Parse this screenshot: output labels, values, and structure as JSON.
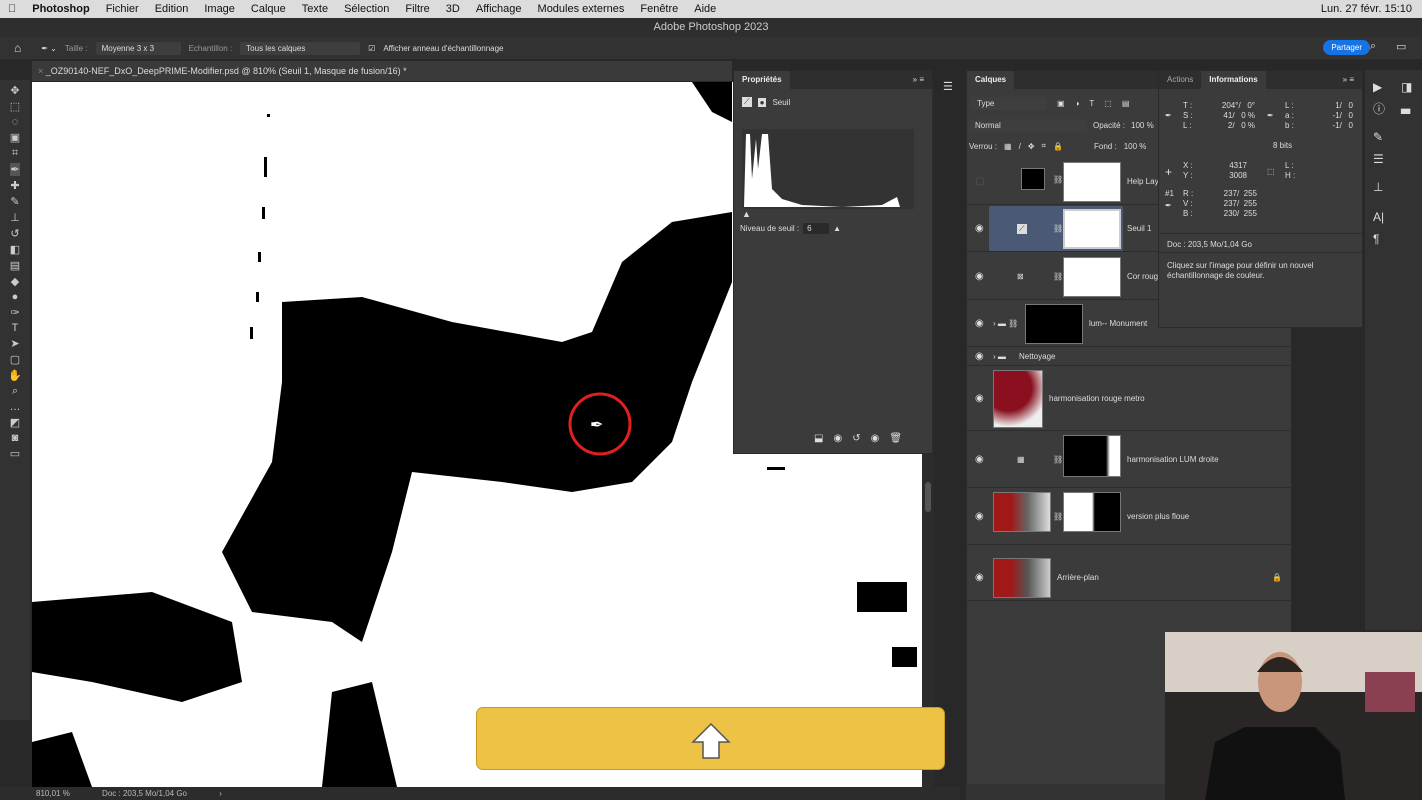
{
  "menubar": {
    "items": [
      "Photoshop",
      "Fichier",
      "Edition",
      "Image",
      "Calque",
      "Texte",
      "Sélection",
      "Filtre",
      "3D",
      "Affichage",
      "Modules externes",
      "Fenêtre",
      "Aide"
    ],
    "clock": "Lun. 27 févr.  15:10"
  },
  "window_title": "Adobe Photoshop 2023",
  "options": {
    "size_label": "Taille :",
    "size_value": "Moyenne 3 x 3",
    "sample_label": "Echantillon :",
    "sample_value": "Tous les calques",
    "ring_label": "Afficher anneau d'échantillonnage",
    "share": "Partager"
  },
  "document_tab": "_OZ90140-NEF_DxO_DeepPRIME-Modifier.psd @ 810% (Seuil 1, Masque de fusion/16) *",
  "status": {
    "zoom": "810,01 %",
    "doc": "Doc : 203,5 Mo/1,04 Go"
  },
  "properties": {
    "title": "Propriétés",
    "type": "Seuil",
    "threshold_label": "Niveau de seuil :",
    "threshold_value": "6"
  },
  "layers": {
    "title": "Calques",
    "filter": "Type",
    "blend": "Normal",
    "opacity_label": "Opacité :",
    "opacity": "100 %",
    "lock_label": "Verrou :",
    "fill_label": "Fond :",
    "fill": "100 %",
    "items": [
      {
        "name": "Help Lay",
        "visible": false
      },
      {
        "name": "Seuil 1",
        "visible": true,
        "selected": true
      },
      {
        "name": "Cor roug",
        "visible": true
      },
      {
        "name": "lum-- Monument",
        "visible": true
      },
      {
        "name": "Nettoyage",
        "visible": true
      },
      {
        "name": "harmonisation rouge metro",
        "visible": true
      },
      {
        "name": "harmonisation LUM droite",
        "visible": true
      },
      {
        "name": "version plus floue",
        "visible": true
      },
      {
        "name": "Arrière-plan",
        "visible": true
      }
    ]
  },
  "info": {
    "tabs": [
      "Actions",
      "Informations"
    ],
    "hsl": "T :\nS :\nL :",
    "hsl_vals": "204°/   0°\n41/   0 %\n2/   0 %",
    "lab": "L :\na :\nb :",
    "lab_vals": "1/   0\n-1/   0\n-1/   0",
    "bits": "8 bits",
    "xy": "X :\nY :",
    "xy_vals": "4317\n3008",
    "wh": "L :\nH :",
    "sample": "#1",
    "rgb": "R :\nV :\nB :",
    "rgb_vals": "237/  255\n237/  255\n230/  255",
    "doc": "Doc : 203,5 Mo/1,04 Go",
    "hint": "Cliquez sur l'image pour définir un nouvel\néchantillonnage de couleur."
  },
  "colors": {
    "accent": "#1473e6",
    "banner": "#eec244",
    "selected_layer": "#4a5a75",
    "cursor_ring": "#e02020"
  }
}
